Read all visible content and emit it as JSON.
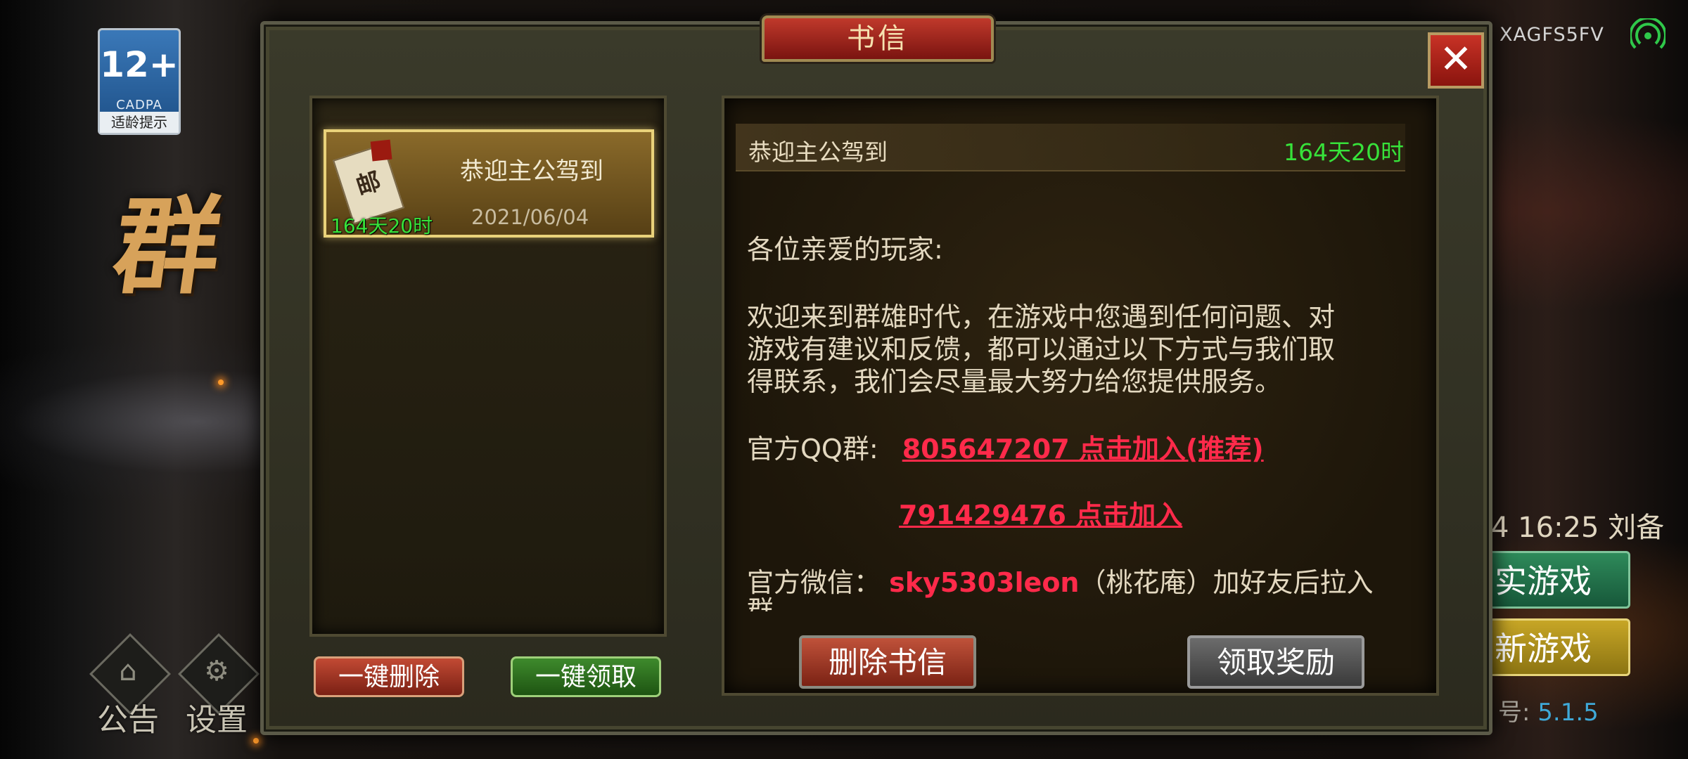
{
  "age_badge": {
    "rating": "12+",
    "org": "CADPA",
    "tip": "适龄提示"
  },
  "background": {
    "title_glyph": "群",
    "device_id": "XAGFS5FV",
    "time_text": "4 16:25 刘备",
    "btn_green": "实游戏",
    "btn_yellow": "新游戏",
    "version_label": "号:",
    "version_value": "5.1.5",
    "bottom_buttons": [
      {
        "label": "公告",
        "icon": "gate-icon"
      },
      {
        "label": "设置",
        "icon": "gear-icon"
      }
    ]
  },
  "dialog": {
    "title": "书信",
    "close_symbol": "✕",
    "mail_list": [
      {
        "title": "恭迎主公驾到",
        "date": "2021/06/04",
        "remaining": "164天20时",
        "icon_text": "邮"
      }
    ],
    "list_buttons": {
      "delete_all": "一键删除",
      "claim_all": "一键领取"
    },
    "content": {
      "subject": "恭迎主公驾到",
      "remaining": "164天20时",
      "greeting": "各位亲爱的玩家:",
      "paragraph_lines": [
        "欢迎来到群雄时代，在游戏中您遇到任何问题、对",
        "游戏有建议和反馈，都可以通过以下方式与我们取",
        "得联系，我们会尽量最大努力给您提供服务。"
      ],
      "qq_label": "官方QQ群:",
      "qq_link_1": "805647207 点击加入(推荐)",
      "qq_link_2": "791429476 点击加入",
      "wechat_label": "官方微信：",
      "wechat_id": "sky5303leon",
      "wechat_note": "（桃花庵）加好友后拉入",
      "wechat_note_cut": "群"
    },
    "content_buttons": {
      "delete": "删除书信",
      "claim": "领取奖励"
    }
  },
  "colors": {
    "timer_green": "#37e23a",
    "link_red": "#ff2a4a",
    "title_red": "#c0392b"
  }
}
